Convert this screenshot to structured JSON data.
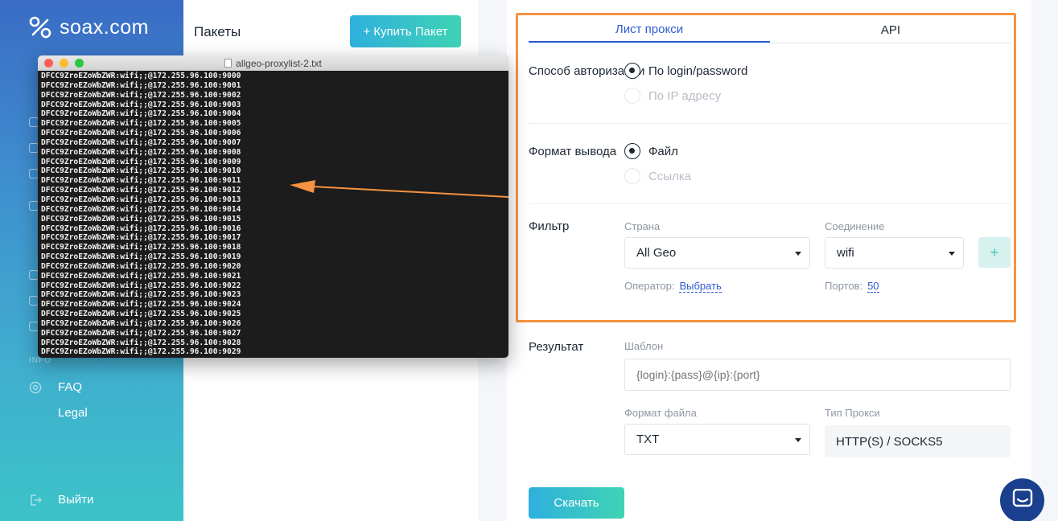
{
  "sidebar": {
    "logo_text": "soax.com",
    "items": [
      {
        "label": "FAQ",
        "icon": "help-circle-icon"
      },
      {
        "label": "Legal",
        "icon": ""
      },
      {
        "label": "Выйти",
        "icon": "logout-icon"
      }
    ],
    "section_labels": [
      "INFO"
    ]
  },
  "packages": {
    "title": "Пакеты",
    "buy_button": "Купить Пакет",
    "buy_icon": "+"
  },
  "tabs": [
    {
      "label": "Лист прокси",
      "active": true
    },
    {
      "label": "API",
      "active": false
    }
  ],
  "auth": {
    "label": "Способ авторизации",
    "options": [
      {
        "label": "По login/password",
        "selected": true
      },
      {
        "label": "По IP адресу",
        "selected": false
      }
    ]
  },
  "output_format": {
    "label": "Формат вывода",
    "options": [
      {
        "label": "Файл",
        "selected": true
      },
      {
        "label": "Ссылка",
        "selected": false
      }
    ]
  },
  "filter": {
    "label": "Фильтр",
    "country_label": "Страна",
    "country_value": "All Geo",
    "connection_label": "Соединение",
    "connection_value": "wifi",
    "add_button": "+",
    "operator_label": "Оператор:",
    "operator_link": "Выбрать",
    "ports_label": "Портов:",
    "ports_value": "50"
  },
  "result": {
    "label": "Результат",
    "template_label": "Шаблон",
    "template_placeholder": "{login}:{pass}@{ip}:{port}",
    "file_format_label": "Формат файла",
    "file_format_value": "TXT",
    "proxy_type_label": "Тип Прокси",
    "proxy_type_value": "HTTP(S) / SOCKS5",
    "download_button": "Скачать"
  },
  "terminal": {
    "filename": "allgeo-proxylist-2.txt",
    "lines": [
      "DFCC9ZroEZoWbZWR:wifi;;@172.255.96.100:9000",
      "DFCC9ZroEZoWbZWR:wifi;;@172.255.96.100:9001",
      "DFCC9ZroEZoWbZWR:wifi;;@172.255.96.100:9002",
      "DFCC9ZroEZoWbZWR:wifi;;@172.255.96.100:9003",
      "DFCC9ZroEZoWbZWR:wifi;;@172.255.96.100:9004",
      "DFCC9ZroEZoWbZWR:wifi;;@172.255.96.100:9005",
      "DFCC9ZroEZoWbZWR:wifi;;@172.255.96.100:9006",
      "DFCC9ZroEZoWbZWR:wifi;;@172.255.96.100:9007",
      "DFCC9ZroEZoWbZWR:wifi;;@172.255.96.100:9008",
      "DFCC9ZroEZoWbZWR:wifi;;@172.255.96.100:9009",
      "DFCC9ZroEZoWbZWR:wifi;;@172.255.96.100:9010",
      "DFCC9ZroEZoWbZWR:wifi;;@172.255.96.100:9011",
      "DFCC9ZroEZoWbZWR:wifi;;@172.255.96.100:9012",
      "DFCC9ZroEZoWbZWR:wifi;;@172.255.96.100:9013",
      "DFCC9ZroEZoWbZWR:wifi;;@172.255.96.100:9014",
      "DFCC9ZroEZoWbZWR:wifi;;@172.255.96.100:9015",
      "DFCC9ZroEZoWbZWR:wifi;;@172.255.96.100:9016",
      "DFCC9ZroEZoWbZWR:wifi;;@172.255.96.100:9017",
      "DFCC9ZroEZoWbZWR:wifi;;@172.255.96.100:9018",
      "DFCC9ZroEZoWbZWR:wifi;;@172.255.96.100:9019",
      "DFCC9ZroEZoWbZWR:wifi;;@172.255.96.100:9020",
      "DFCC9ZroEZoWbZWR:wifi;;@172.255.96.100:9021",
      "DFCC9ZroEZoWbZWR:wifi;;@172.255.96.100:9022",
      "DFCC9ZroEZoWbZWR:wifi;;@172.255.96.100:9023",
      "DFCC9ZroEZoWbZWR:wifi;;@172.255.96.100:9024",
      "DFCC9ZroEZoWbZWR:wifi;;@172.255.96.100:9025",
      "DFCC9ZroEZoWbZWR:wifi;;@172.255.96.100:9026",
      "DFCC9ZroEZoWbZWR:wifi;;@172.255.96.100:9027",
      "DFCC9ZroEZoWbZWR:wifi;;@172.255.96.100:9028",
      "DFCC9ZroEZoWbZWR:wifi;;@172.255.96.100:9029"
    ]
  },
  "colors": {
    "accent_blue": "#2e5bd6",
    "highlight_orange": "#f59342",
    "button_gradient_start": "#2fb0de",
    "button_gradient_end": "#3fd3b4",
    "sidebar_top": "#3a6cc4",
    "sidebar_bottom": "#3cc3c8"
  }
}
